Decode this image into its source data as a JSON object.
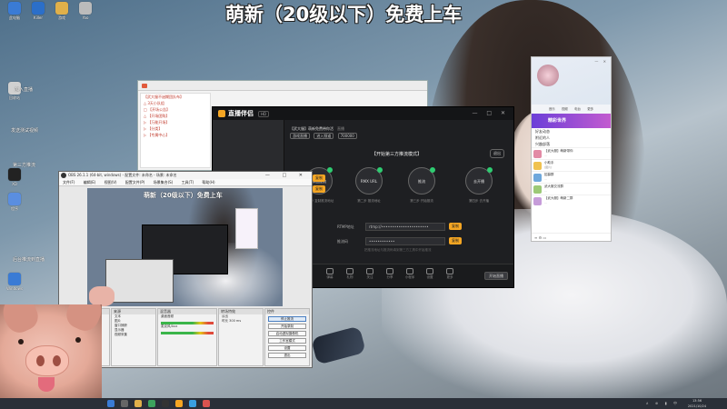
{
  "banner": "萌新（20级以下）免费上车",
  "desktop_icons": [
    {
      "label": "此电脑",
      "color": "#3a7bd5"
    },
    {
      "label": "Killer",
      "color": "#2b6fc9"
    },
    {
      "label": "游戏",
      "color": "#e0b04a"
    },
    {
      "label": "Yoo",
      "color": "#bbbbbb"
    },
    {
      "label": "回收站",
      "color": "#d0d0d0"
    },
    {
      "label": "XD",
      "color": "#222222"
    },
    {
      "label": "程序",
      "color": "#5a8ee0"
    },
    {
      "label": "Windows",
      "color": "#3a7bd5"
    }
  ],
  "desktop_text": [
    "加入直播",
    "发送测试视频",
    "第三方推流",
    "后台推流到直播"
  ],
  "browser": {
    "tree": [
      "【武大服不迷糊团队布】",
      "△ 3天小队组",
      "□ 【开场公告】",
      "△ 【开场团购】",
      "▷ 【万能开场】",
      "▷ 【分类】",
      "▷ 【专属中心】"
    ]
  },
  "stream": {
    "app_name": "直播伴侣",
    "version": "HD",
    "window_buttons": "— □ ✕",
    "room_title": "【武大服】萌新免费带你活",
    "room_badge": "直播",
    "room_tags": [
      "游戏直播",
      "进入频道",
      "700000"
    ],
    "mode_label": "【开始第三方推流模式】",
    "mode_chip": "退出",
    "steps": [
      {
        "label": "添加推流",
        "caption": "第一步 复制推流地址"
      },
      {
        "label": "RMX URL",
        "caption": "第二步 推流地址"
      },
      {
        "label": "推流",
        "caption": "第三步 开始推流"
      },
      {
        "label": "去开播",
        "caption": "第四步 去开播"
      }
    ],
    "button_text": "复制",
    "rtmp_label": "RTMP地址",
    "rtmp_value": "rtmp://••••••••••••••••••••••",
    "key_label": "推流码",
    "key_value": "••••••••••••",
    "hint": "把推流地址与推流码填到第三方工具中开始推流",
    "toolbar": [
      "弹幕",
      "礼物",
      "关注",
      "分享",
      "小程序",
      "设置",
      "更多"
    ],
    "start_button": "开始直播"
  },
  "obs": {
    "title": "OBS 26.1.1 (64-bit, windows) - 配置文件: 未命名 - 场景: 未命名",
    "window_buttons": "— □ ✕",
    "menu": [
      "文件(F)",
      "编辑(E)",
      "视图(V)",
      "配置文件(P)",
      "场景集合(S)",
      "工具(T)",
      "帮助(H)"
    ],
    "preview_banner": "萌新（20级以下）免费上车",
    "docks": {
      "scenes_title": "场景",
      "sources_title": "来源",
      "sources": [
        "文本",
        "图片",
        "窗口捕获",
        "显示器",
        "视频采集"
      ],
      "mixer_title": "混音器",
      "mixer": [
        "桌面音频",
        "麦克风/Aux"
      ],
      "transition_title": "转场特效",
      "transition_value": "淡出",
      "duration_label": "时长",
      "duration_value": "300 ms",
      "controls_title": "控件",
      "controls": [
        "停止推流",
        "开始录制",
        "启动虚拟摄像机",
        "工作室模式",
        "设置",
        "退出"
      ]
    }
  },
  "qq": {
    "top_buttons": "— ✕",
    "tabs": [
      "音乐",
      "视频",
      "电台",
      "更多"
    ],
    "promo": "精彩世界",
    "menu": [
      "好友动态",
      "附近的人",
      "兴趣部落"
    ],
    "chats": [
      {
        "name": "【武大服】萌新带你",
        "msg": "...",
        "color": "#e28aa5"
      },
      {
        "name": "小助手",
        "msg": "[图片]",
        "color": "#f0c24f"
      },
      {
        "name": "招募群",
        "msg": "...",
        "color": "#6fa8dc"
      },
      {
        "name": "武大服交流群",
        "msg": "...",
        "color": "#9cc977"
      },
      {
        "name": "【武大服】萌新二群",
        "msg": "...",
        "color": "#c69cd9"
      }
    ],
    "bottom": "≡  ⚙  ▭"
  },
  "taskbar": {
    "apps": [
      {
        "name": "start",
        "color": "#3a7bd5"
      },
      {
        "name": "search",
        "color": "#666666"
      },
      {
        "name": "explorer",
        "color": "#e0b04a"
      },
      {
        "name": "chrome",
        "color": "#3da35d"
      },
      {
        "name": "obs",
        "color": "#333333"
      },
      {
        "name": "stream",
        "color": "#f5a623"
      },
      {
        "name": "qq",
        "color": "#3a9fe0"
      },
      {
        "name": "music",
        "color": "#d9534f"
      }
    ],
    "tray": "∧ ⊕ ▮ 中",
    "time": "13:56",
    "date": "2021/10/24"
  }
}
